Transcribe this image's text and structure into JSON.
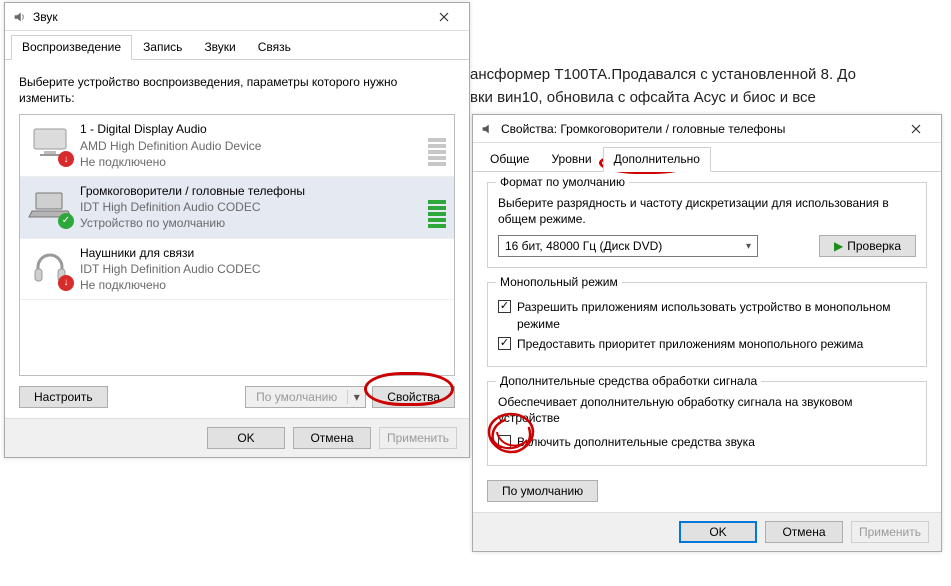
{
  "background_text": "ансформер Т100ТА.Продавался с установленной 8. До\nвки вин10, обновила с офсайта Асус и биос и все",
  "sound_window": {
    "title": "Звук",
    "tabs": [
      "Воспроизведение",
      "Запись",
      "Звуки",
      "Связь"
    ],
    "active_tab": 0,
    "instruction": "Выберите устройство воспроизведения, параметры которого нужно изменить:",
    "devices": [
      {
        "title": "1 - Digital Display Audio",
        "sub": "AMD High Definition Audio Device",
        "status": "Не подключено",
        "badge": "down",
        "selected": false,
        "meter": "inactive"
      },
      {
        "title": "Громкоговорители / головные телефоны",
        "sub": "IDT High Definition Audio CODEC",
        "status": "Устройство по умолчанию",
        "badge": "check",
        "selected": true,
        "meter": "active"
      },
      {
        "title": "Наушники для связи",
        "sub": "IDT High Definition Audio CODEC",
        "status": "Не подключено",
        "badge": "down",
        "selected": false,
        "meter": "none"
      }
    ],
    "configure_btn": "Настроить",
    "default_btn": "По умолчанию",
    "properties_btn": "Свойства",
    "ok": "OK",
    "cancel": "Отмена",
    "apply": "Применить"
  },
  "props_window": {
    "title": "Свойства: Громкоговорители / головные телефоны",
    "tabs": [
      "Общие",
      "Уровни",
      "Дополнительно"
    ],
    "active_tab": 2,
    "format_group": {
      "legend": "Формат по умолчанию",
      "desc": "Выберите разрядность и частоту дискретизации для использования в общем режиме.",
      "select_value": "16 бит, 48000 Гц (Диск DVD)",
      "test_btn": "Проверка"
    },
    "exclusive_group": {
      "legend": "Монопольный режим",
      "cb1": {
        "checked": true,
        "label": "Разрешить приложениям использовать устройство в монопольном режиме"
      },
      "cb2": {
        "checked": true,
        "label": "Предоставить приоритет приложениям монопольного режима"
      }
    },
    "enhance_group": {
      "legend": "Дополнительные средства обработки сигнала",
      "desc": "Обеспечивает дополнительную обработку сигнала на звуковом устройстве",
      "cb": {
        "checked": false,
        "label": "Включить дополнительные средства звука"
      }
    },
    "defaults_btn": "По умолчанию",
    "ok": "OK",
    "cancel": "Отмена",
    "apply": "Применить"
  }
}
